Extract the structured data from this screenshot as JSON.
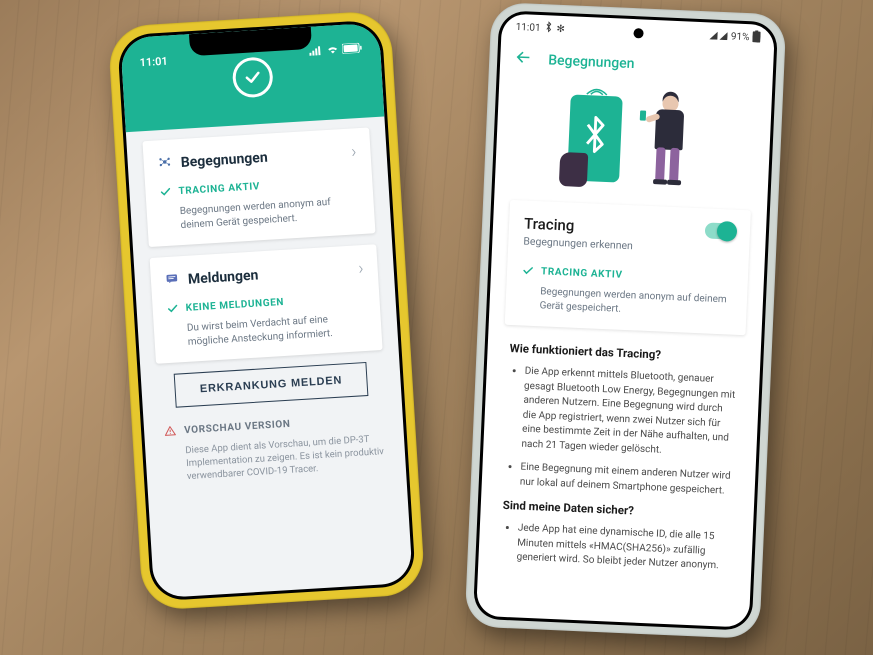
{
  "left": {
    "statusbar": {
      "time": "11:01"
    },
    "cards": {
      "encounters": {
        "title": "Begegnungen",
        "status": "TRACING AKTIV",
        "desc": "Begegnungen werden anonym auf deinem Gerät gespeichert."
      },
      "reports": {
        "title": "Meldungen",
        "status": "KEINE MELDUNGEN",
        "desc": "Du wirst beim Verdacht auf eine mögliche Ansteckung informiert."
      }
    },
    "button": "ERKRANKUNG MELDEN",
    "preview": {
      "title": "VORSCHAU VERSION",
      "desc": "Diese App dient als Vorschau, um die DP-3T Implementation zu zeigen. Es ist kein produktiv verwendbarer COVID-19 Tracer."
    }
  },
  "right": {
    "statusbar": {
      "time": "11:01",
      "battery": "91%"
    },
    "appbar": {
      "title": "Begegnungen"
    },
    "tracing": {
      "title": "Tracing",
      "subtitle": "Begegnungen erkennen",
      "status": "TRACING AKTIV",
      "desc": "Begegnungen werden anonym auf deinem Gerät gespeichert."
    },
    "info": {
      "q1": "Wie funktioniert das Tracing?",
      "a1": [
        "Die App erkennt mittels Bluetooth, genauer gesagt Bluetooth Low Energy, Begegnungen mit anderen Nutzern. Eine Begegnung wird durch die App registriert, wenn zwei Nutzer sich für eine bestimmte Zeit in der Nähe aufhalten, und nach 21 Tagen wieder gelöscht.",
        "Eine Begegnung mit einem anderen Nutzer wird nur lokal auf deinem Smartphone gespeichert."
      ],
      "q2": "Sind meine Daten sicher?",
      "a2": [
        "Jede App hat eine dynamische ID, die alle 15 Minuten mittels «HMAC(SHA256)» zufällig generiert wird. So bleibt jeder Nutzer anonym."
      ]
    }
  }
}
